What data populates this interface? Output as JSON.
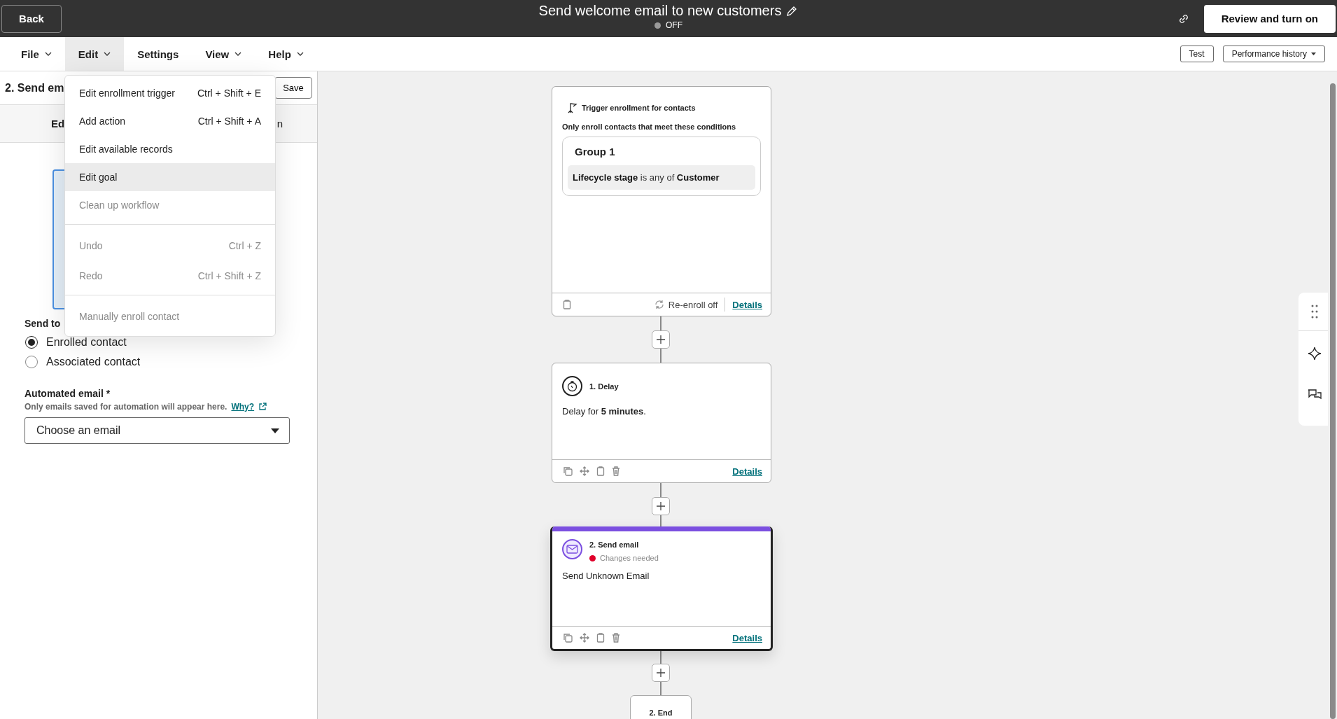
{
  "header": {
    "back": "Back",
    "title": "Send welcome email to new customers",
    "status": "OFF",
    "status_on": false,
    "primary": "Review and turn on"
  },
  "menubar": {
    "items": [
      {
        "label": "File",
        "dropdown": true,
        "selected": false
      },
      {
        "label": "Edit",
        "dropdown": true,
        "selected": true
      },
      {
        "label": "Settings",
        "dropdown": false,
        "selected": false
      },
      {
        "label": "View",
        "dropdown": true,
        "selected": false
      },
      {
        "label": "Help",
        "dropdown": true,
        "selected": false
      }
    ],
    "buttons": [
      {
        "label": "Test",
        "dropdown": false
      },
      {
        "label": "Performance history",
        "dropdown": true
      }
    ]
  },
  "menu": {
    "items": [
      {
        "label": "Edit enrollment trigger",
        "shortcut": "Ctrl + Shift + E",
        "disabled": false,
        "selected": false,
        "divider_before": false
      },
      {
        "label": "Add action",
        "shortcut": "Ctrl + Shift + A",
        "disabled": false,
        "selected": false,
        "divider_before": false
      },
      {
        "label": "Edit available records",
        "disabled": false,
        "selected": false,
        "divider_before": false
      },
      {
        "label": "Edit goal",
        "disabled": false,
        "selected": true,
        "divider_before": false
      },
      {
        "label": "Clean up workflow",
        "disabled": true,
        "selected": false,
        "divider_before": false
      },
      {
        "label": "Undo",
        "shortcut": "Ctrl + Z",
        "disabled": true,
        "selected": false,
        "divider_before": true
      },
      {
        "label": "Redo",
        "shortcut": "Ctrl + Shift + Z",
        "disabled": true,
        "selected": false,
        "divider_before": false
      },
      {
        "label": "Manually enroll contact",
        "disabled": true,
        "selected": false,
        "divider_before": true
      }
    ]
  },
  "panel": {
    "title": "2. Send em",
    "save": "Save",
    "tabs": [
      {
        "label": "Ed",
        "selected": true
      },
      {
        "label": "n",
        "selected": false
      }
    ],
    "send_to": "Send to",
    "radios": [
      {
        "label": "Enrolled contact",
        "selected": true
      },
      {
        "label": "Associated contact",
        "selected": false
      }
    ],
    "email_label": "Automated email *",
    "help": "Only emails saved for automation will appear here.",
    "help_link": "Why?",
    "select_placeholder": "Choose an email"
  },
  "canvas": {
    "nodes": [
      {
        "kind": "trigger",
        "title": "Trigger enrollment for contacts",
        "subtitle": "Only enroll contacts that meet these conditions",
        "group": "Group 1",
        "condition": "**Lifecycle stage** is any of **Customer**",
        "reenroll": "Re-enroll off",
        "details": "Details",
        "selected": false
      },
      {
        "kind": "delay",
        "title": "1. Delay",
        "body": "Delay for **5 minutes**.",
        "details": "Details",
        "selected": false
      },
      {
        "kind": "email",
        "title": "2. Send email",
        "status": "Changes needed",
        "body": "Send Unknown Email",
        "details": "Details",
        "selected": true
      },
      {
        "kind": "end",
        "title": "2. End"
      }
    ]
  }
}
